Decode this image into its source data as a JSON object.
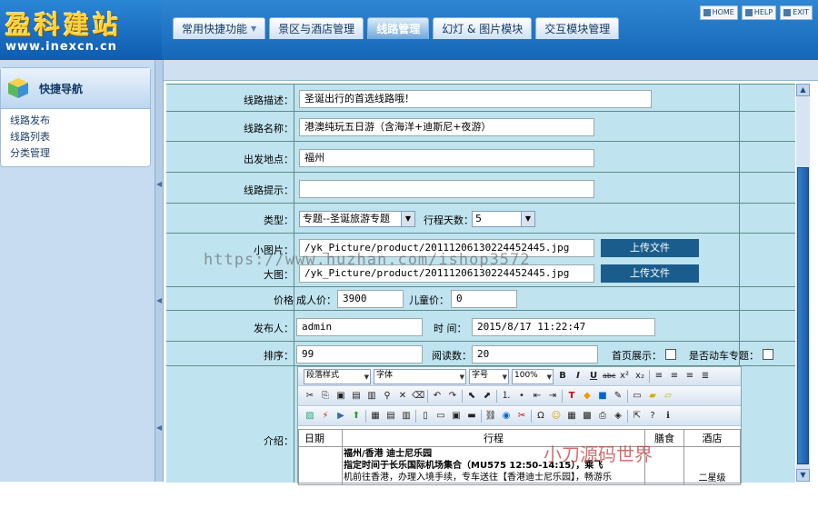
{
  "logo": {
    "title": "盈科建站",
    "url": "www.inexcn.cn"
  },
  "sysbar": {
    "home": "HOME",
    "help": "HELP",
    "exit": "EXIT"
  },
  "tabs": [
    "常用快捷功能",
    "景区与酒店管理",
    "线路管理",
    "幻灯 & 图片模块",
    "交互模块管理"
  ],
  "sidebar": {
    "title": "快捷导航",
    "items": [
      "线路发布",
      "线路列表",
      "分类管理"
    ]
  },
  "form": {
    "desc_label": "线路描述：",
    "desc_value": "圣诞出行的首选线路哦！",
    "name_label": "线路名称：",
    "name_value": "港澳纯玩五日游（含海洋+迪斯尼+夜游）",
    "origin_label": "出发地点：",
    "origin_value": "福州",
    "tip_label": "线路提示：",
    "tip_value": "",
    "type_label": "类型：",
    "type_value": "专题--圣诞旅游专题",
    "days_label": "行程天数：",
    "days_value": "5",
    "small_img_label": "小图片：",
    "small_img_value": "/yk_Picture/product/20111206130224452445.jpg",
    "big_img_label": "大图：",
    "big_img_value": "/yk_Picture/product/20111206130224452445.jpg",
    "upload_label": "上传文件",
    "price_label": "价格",
    "adult_label": "成人价：",
    "adult_value": "3900",
    "child_label": "儿童价：",
    "child_value": "0",
    "publisher_label": "发布人：",
    "publisher_value": "admin",
    "time_label": "时  间：",
    "time_value": "2015/8/17 11:22:47",
    "order_label": "排序：",
    "order_value": "99",
    "reads_label": "阅读数：",
    "reads_value": "20",
    "home_show_label": "首页展示：",
    "is_train_label": "是否动车专题：",
    "intro_label": "介绍："
  },
  "editor": {
    "style_select": "段落样式",
    "font_select": "字体",
    "size_select": "字号",
    "zoom_select": "100%",
    "table_headers": [
      "日期",
      "行程",
      "膳食",
      "酒店"
    ],
    "row1_title": "福州/香港   迪士尼乐园",
    "row1_line2": "指定时间于长乐国际机场集合（MU575 12:50-14:15），乘飞",
    "row1_line3": "机前往香港，办理入境手续，专车送往【香港迪士尼乐园】，畅游乐",
    "row1_hotel": "二星级"
  },
  "watermarks": {
    "url": "https://www.huzhan.com/ishop3572",
    "brand": "小刀源码世界"
  }
}
